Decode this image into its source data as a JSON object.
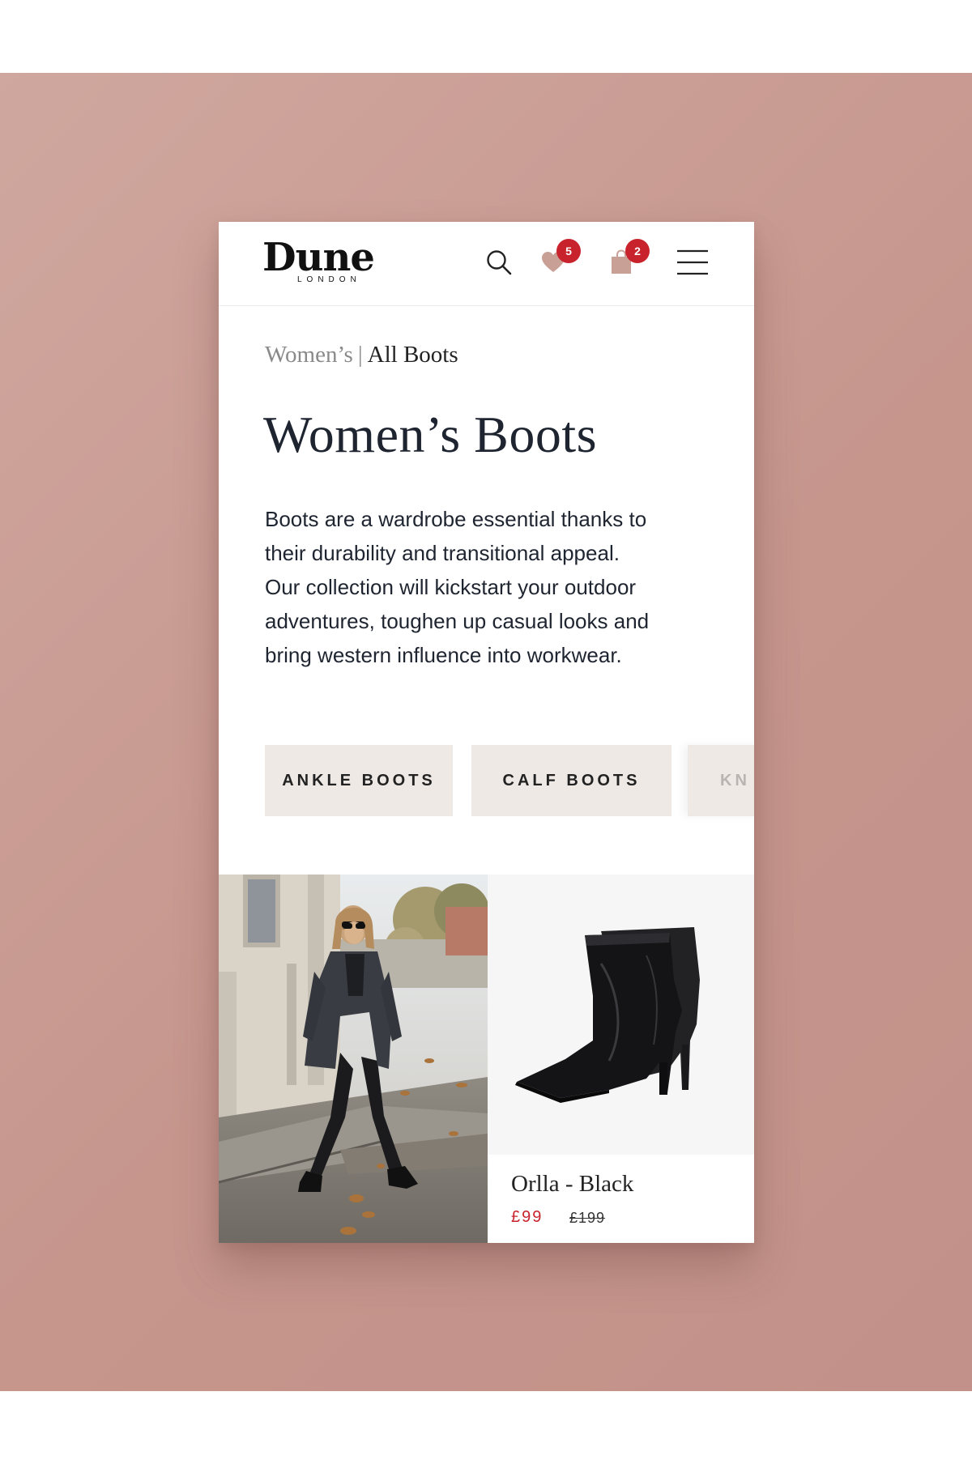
{
  "brand": {
    "name": "Dune",
    "sub": "LONDON"
  },
  "header": {
    "wishlist_count": "5",
    "bag_count": "2"
  },
  "breadcrumb": {
    "parent": "Women’s",
    "separator": "|",
    "current": "All Boots"
  },
  "page": {
    "title": "Women’s Boots",
    "intro": "Boots are a wardrobe essential thanks to their durability and transitional appeal. Our collection will kickstart your outdoor adventures, toughen up casual looks and bring western influence into workwear."
  },
  "categories": [
    {
      "label": "ANKLE BOOTS"
    },
    {
      "label": "CALF BOOTS"
    },
    {
      "label": "KN"
    }
  ],
  "product": {
    "name": "Orlla - Black",
    "price": "£99",
    "was_price": "£199"
  },
  "colors": {
    "backdrop": "#c8998f",
    "badge": "#c8232c",
    "chip": "#efe9e5",
    "sale_price": "#c8232c",
    "heart_bag_icon": "#c9a096"
  },
  "icons": {
    "search": "search-icon",
    "wishlist": "heart-icon",
    "bag": "shopping-bag-icon",
    "menu": "hamburger-menu-icon"
  }
}
